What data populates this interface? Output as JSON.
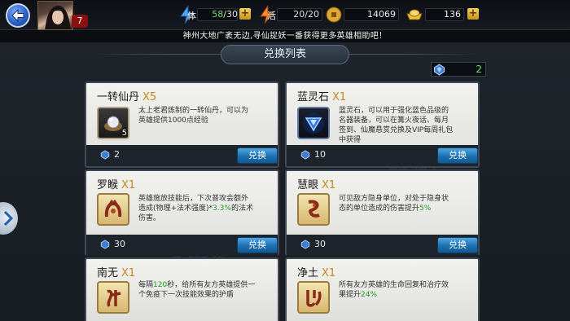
{
  "header": {
    "player_level": "7",
    "stamina_label": "体",
    "stamina": "58",
    "stamina_max": "/30",
    "energy_label": "活",
    "energy": "20/20",
    "coins": "14069",
    "gold": "136"
  },
  "notice": "神州大地广袤无边,寻仙捉妖一番获得更多英雄相助吧！",
  "section_title": "兑换列表",
  "gem_balance": "2",
  "exchange_button_label": "兑换",
  "items": [
    {
      "name": "一转仙丹",
      "qty": "X5",
      "icon": "pill-pearl-icon",
      "count": "5",
      "desc": [
        "太上老君炼制的一转仙丹，可以为",
        "英雄提供1000点经验"
      ],
      "cost": "2"
    },
    {
      "name": "蓝灵石",
      "qty": "X1",
      "icon": "blue-crystal-icon",
      "count": "",
      "desc": [
        "蓝灵石，可以用于强化蓝色品级的",
        "名器装备，可以在篝火夜话、每月",
        "签到、仙魔悬赏兑换及VIP每周礼包",
        "中获得"
      ],
      "cost": "10"
    },
    {
      "name": "罗睺",
      "qty": "X1",
      "icon": "luohou-rune-icon",
      "count": "",
      "desc_pre": [
        "英雄施放技能后，下次普攻会额外",
        "造成(物理+法术强度)*"
      ],
      "desc_highlight": "3.3%",
      "desc_post": "的法术",
      "desc_last": "伤害。",
      "cost": "30"
    },
    {
      "name": "慧眼",
      "qty": "X1",
      "icon": "eye-rune-icon",
      "count": "",
      "desc_pre": [
        "可见敌方隐身单位，对处于隐身状",
        "态的单位造成的伤害提升"
      ],
      "desc_highlight": "5%",
      "cost": "30"
    },
    {
      "name": "南无",
      "qty": "X1",
      "icon": "namo-rune-icon",
      "count": "",
      "desc_a": "每隔",
      "desc_highlight": "120",
      "desc_b": "秒，给所有友方英雄提供一",
      "desc_c": "个免疫下一次技能效果的护盾"
    },
    {
      "name": "净土",
      "qty": "X1",
      "icon": "pureland-rune-icon",
      "count": "",
      "desc_a": "所有友方英雄的生命回复和治疗效",
      "desc_b": "果提升",
      "desc_highlight": "24%"
    }
  ]
}
